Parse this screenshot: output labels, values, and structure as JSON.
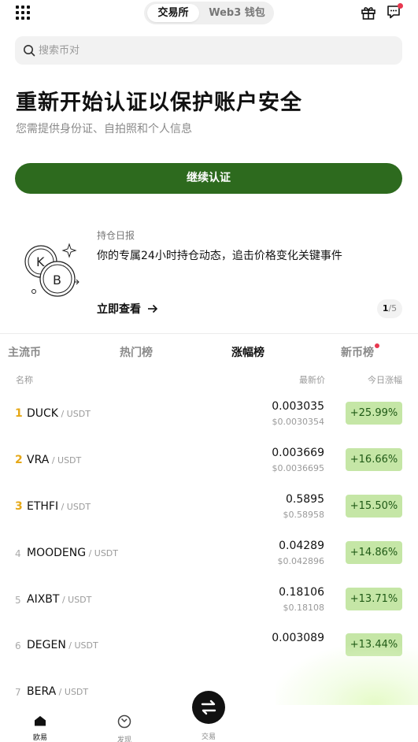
{
  "header": {
    "tabs": [
      {
        "label": "交易所",
        "active": true
      },
      {
        "label": "Web3 钱包",
        "active": false
      }
    ],
    "icons": [
      "grid-menu-icon",
      "gift-icon",
      "message-icon"
    ]
  },
  "search": {
    "placeholder": "搜索币对"
  },
  "hero": {
    "title": "重新开始认证以保护账户安全",
    "subtitle": "您需提供身份证、自拍照和个人信息",
    "button_label": "继续认证",
    "button_color": "#2d6a1e"
  },
  "banner": {
    "label": "持仓日报",
    "text": "你的专属24小时持仓动态，追击价格变化关键事件",
    "link": "立即查看",
    "pager_current": "1",
    "pager_total": "/5"
  },
  "market": {
    "tabs": [
      "主流币",
      "热门榜",
      "涨幅榜",
      "新币榜"
    ],
    "active_tab": "涨幅榜",
    "columns": {
      "name": "名称",
      "price": "最新价",
      "change": "今日涨幅"
    },
    "rows": [
      {
        "rank": "1",
        "symbol": "DUCK",
        "quote": " / USDT",
        "price": "0.003035",
        "fiat": "$0.0030354",
        "change": "+25.99%"
      },
      {
        "rank": "2",
        "symbol": "VRA",
        "quote": " / USDT",
        "price": "0.003669",
        "fiat": "$0.0036695",
        "change": "+16.66%"
      },
      {
        "rank": "3",
        "symbol": "ETHFI",
        "quote": " / USDT",
        "price": "0.5895",
        "fiat": "$0.58958",
        "change": "+15.50%"
      },
      {
        "rank": "4",
        "symbol": "MOODENG",
        "quote": " / USDT",
        "price": "0.04289",
        "fiat": "$0.042896",
        "change": "+14.86%"
      },
      {
        "rank": "5",
        "symbol": "AIXBT",
        "quote": " / USDT",
        "price": "0.18106",
        "fiat": "$0.18108",
        "change": "+13.71%"
      },
      {
        "rank": "6",
        "symbol": "DEGEN",
        "quote": " / USDT",
        "price": "0.003089",
        "fiat": "",
        "change": "+13.44%"
      },
      {
        "rank": "7",
        "symbol": "BERA",
        "quote": " / USDT",
        "price": "",
        "fiat": "",
        "change": ""
      }
    ],
    "change_color": "#c5e6a6"
  },
  "bottom_nav": [
    {
      "label": "欧易",
      "icon": "home-icon",
      "active": true
    },
    {
      "label": "发现",
      "icon": "discover-icon",
      "active": false
    },
    {
      "label": "交易",
      "icon": "trade-swap-icon",
      "active": false
    }
  ]
}
